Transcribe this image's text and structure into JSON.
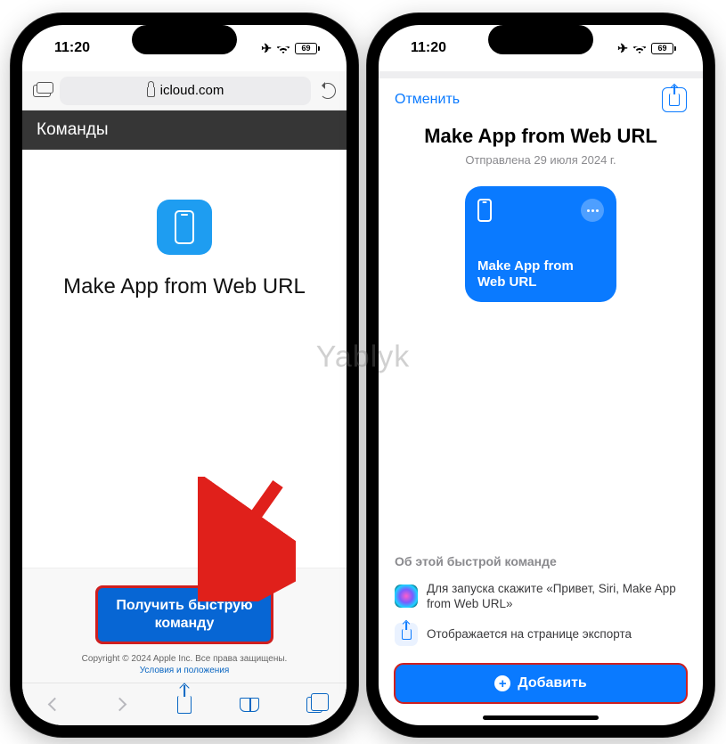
{
  "watermark": "Yablyk",
  "status": {
    "time": "11:20",
    "battery": "69"
  },
  "left": {
    "url_domain": "icloud.com",
    "titlebar": "Команды",
    "app_name": "Make App from Web URL",
    "get_button_line1": "Получить быструю",
    "get_button_line2": "команду",
    "copyright": "Copyright © 2024 Apple Inc. Все права защищены.",
    "terms": "Условия и положения"
  },
  "right": {
    "cancel": "Отменить",
    "title": "Make App from Web URL",
    "sent": "Отправлена 29 июля 2024 г.",
    "card_name": "Make App from Web URL",
    "about_heading": "Об этой быстрой команде",
    "siri_text": "Для запуска скажите «Привет, Siri, Make App from Web URL»",
    "export_text": "Отображается на странице экспорта",
    "add_button": "Добавить"
  }
}
